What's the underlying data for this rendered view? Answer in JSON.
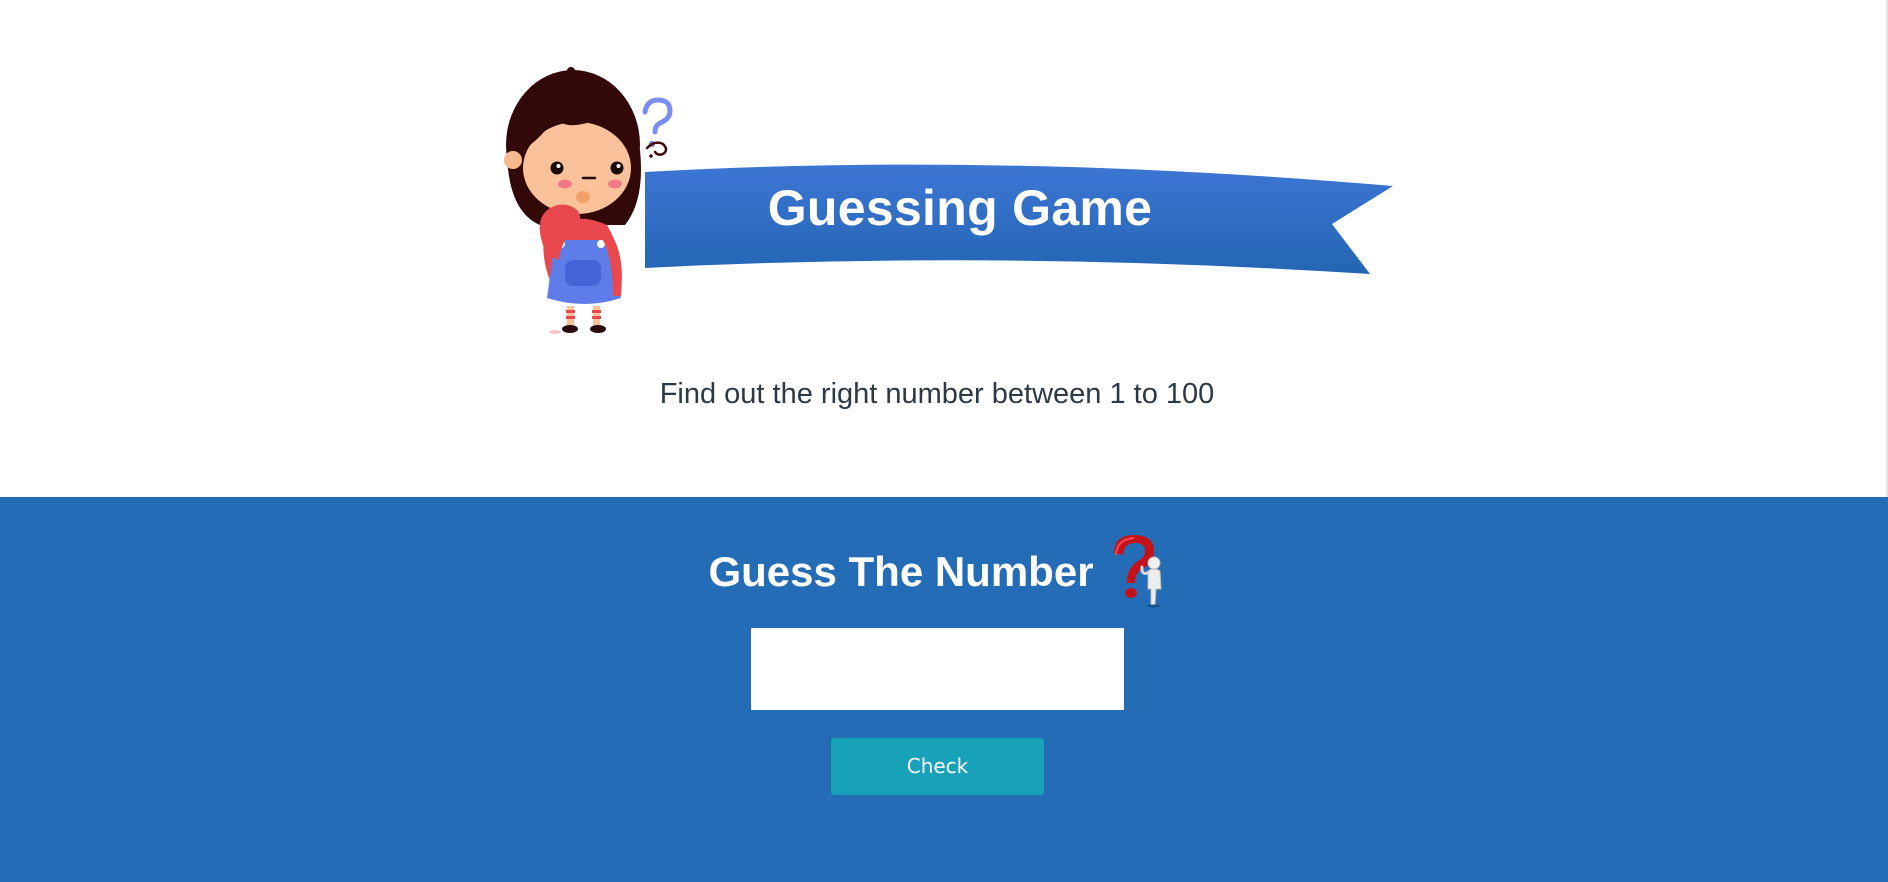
{
  "hero": {
    "title": "Guessing Game",
    "illustration": "thinking-girl-illustration",
    "banner_color": "#2a6dbd"
  },
  "subtitle": "Find out the right number between 1 to 100",
  "game": {
    "heading": "Guess The Number",
    "heading_icon": "question-mark-figure-icon",
    "input": {
      "value": "",
      "placeholder": ""
    },
    "check_label": "Check",
    "section_color": "#256cb6",
    "button_color": "#17a2b8"
  }
}
